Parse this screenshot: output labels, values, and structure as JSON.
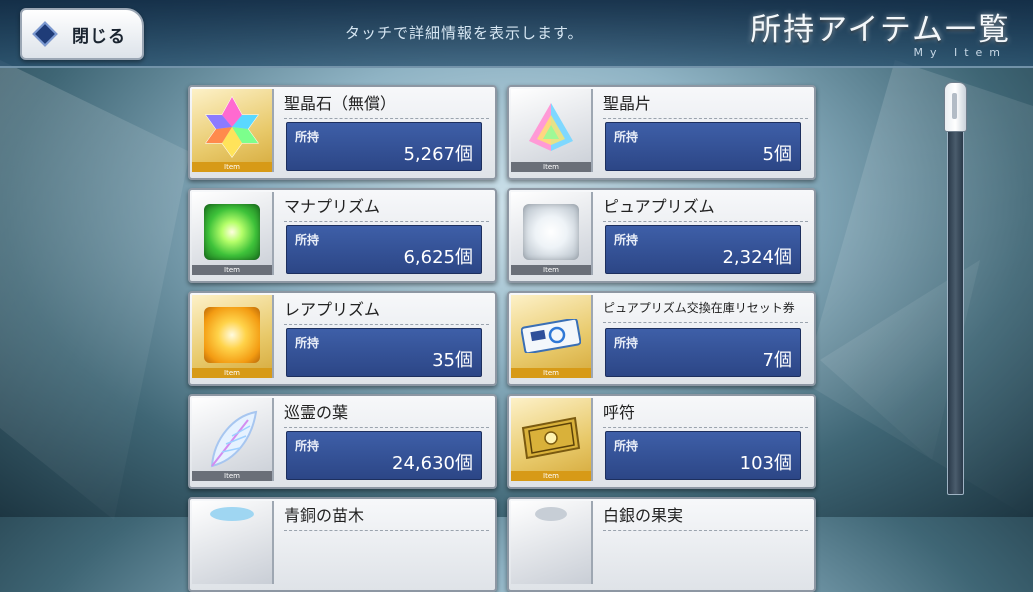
{
  "header": {
    "back_label": "閉じる",
    "hint": "タッチで詳細情報を表示します。",
    "title": "所持アイテム一覧",
    "subtitle": "My Item"
  },
  "items": [
    {
      "name": "聖晶石（無償）",
      "owned_label": "所持",
      "quantity": "5,267個",
      "icon": "saint-quartz-icon",
      "rarity": "gold",
      "tag": "Item"
    },
    {
      "name": "聖晶片",
      "owned_label": "所持",
      "quantity": "5個",
      "icon": "quartz-fragment-icon",
      "rarity": "silver",
      "tag": "Item"
    },
    {
      "name": "マナプリズム",
      "owned_label": "所持",
      "quantity": "6,625個",
      "icon": "mana-prism-icon",
      "rarity": "silver",
      "tag": "Item"
    },
    {
      "name": "ピュアプリズム",
      "owned_label": "所持",
      "quantity": "2,324個",
      "icon": "pure-prism-icon",
      "rarity": "silver",
      "tag": "Item"
    },
    {
      "name": "レアプリズム",
      "owned_label": "所持",
      "quantity": "35個",
      "icon": "rare-prism-icon",
      "rarity": "gold",
      "tag": "Item"
    },
    {
      "name": "ピュアプリズム交換在庫リセット券",
      "owned_label": "所持",
      "quantity": "7個",
      "icon": "reset-ticket-icon",
      "rarity": "gold",
      "tag": "Item"
    },
    {
      "name": "巡霊の葉",
      "owned_label": "所持",
      "quantity": "24,630個",
      "icon": "spirit-leaf-icon",
      "rarity": "silver",
      "tag": "Item"
    },
    {
      "name": "呼符",
      "owned_label": "所持",
      "quantity": "103個",
      "icon": "summon-ticket-icon",
      "rarity": "gold",
      "tag": "Item"
    },
    {
      "name": "青銅の苗木",
      "owned_label": "",
      "quantity": "",
      "icon": "bronze-sapling-icon",
      "rarity": "silver",
      "tag": ""
    },
    {
      "name": "白銀の果実",
      "owned_label": "",
      "quantity": "",
      "icon": "silver-fruit-icon",
      "rarity": "silver",
      "tag": ""
    }
  ],
  "scroll": {
    "position": 0.0
  }
}
